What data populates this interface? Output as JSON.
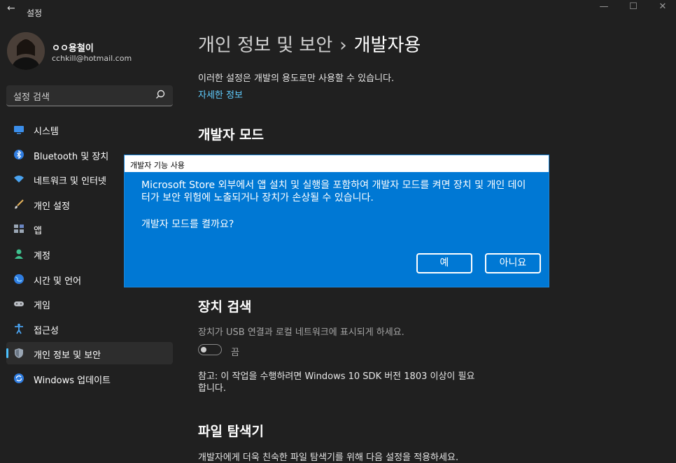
{
  "window": {
    "title": "설정",
    "back_glyph": "←",
    "minimize_glyph": "—",
    "maximize_glyph": "☐",
    "close_glyph": "✕"
  },
  "profile": {
    "name": "ㅇㅇ용철이",
    "email": "cchkill@hotmail.com"
  },
  "search": {
    "placeholder": "설정 검색"
  },
  "nav": {
    "items": [
      {
        "label": "시스템",
        "icon": "system-icon"
      },
      {
        "label": "Bluetooth 및 장치",
        "icon": "bluetooth-icon"
      },
      {
        "label": "네트워크 및 인터넷",
        "icon": "network-icon"
      },
      {
        "label": "개인 설정",
        "icon": "brush-icon"
      },
      {
        "label": "앱",
        "icon": "apps-icon"
      },
      {
        "label": "계정",
        "icon": "account-icon"
      },
      {
        "label": "시간 및 언어",
        "icon": "globe-icon"
      },
      {
        "label": "게임",
        "icon": "gamepad-icon"
      },
      {
        "label": "접근성",
        "icon": "accessibility-icon"
      },
      {
        "label": "개인 정보 및 보안",
        "icon": "shield-icon",
        "active": true
      },
      {
        "label": "Windows 업데이트",
        "icon": "update-icon"
      }
    ]
  },
  "main": {
    "breadcrumb_parent": "개인 정보 및 보안",
    "breadcrumb_sep": "›",
    "breadcrumb_current": "개발자용",
    "description": "이러한 설정은 개발의 용도로만 사용할 수 있습니다.",
    "more_info_link": "자세한 정보",
    "dev_mode_heading": "개발자 모드",
    "device_discovery_heading": "장치 검색",
    "device_discovery_desc": "장치가 USB 연결과 로컬 네트워크에 표시되게 하세요.",
    "toggle_state": "끔",
    "note": "참고: 이 작업을 수행하려면 Windows 10 SDK 버전 1803 이상이 필요합니다.",
    "file_explorer_heading": "파일 탐색기",
    "file_explorer_desc": "개발자에게 더욱 친숙한 파일 탐색기를 위해 다음 설정을 적용하세요."
  },
  "dialog": {
    "title": "개발자 기능 사용",
    "message": "Microsoft Store 외부에서 앱 설치 및 실행을 포함하여 개발자 모드를 켜면 장치 및 개인 데이터가 보안 위험에 노출되거나 장치가 손상될 수 있습니다.",
    "question": "개발자 모드를 켤까요?",
    "yes_label": "예",
    "no_label": "아니요"
  },
  "colors": {
    "background": "#202020",
    "accent": "#0078d4",
    "link": "#60cdff"
  }
}
